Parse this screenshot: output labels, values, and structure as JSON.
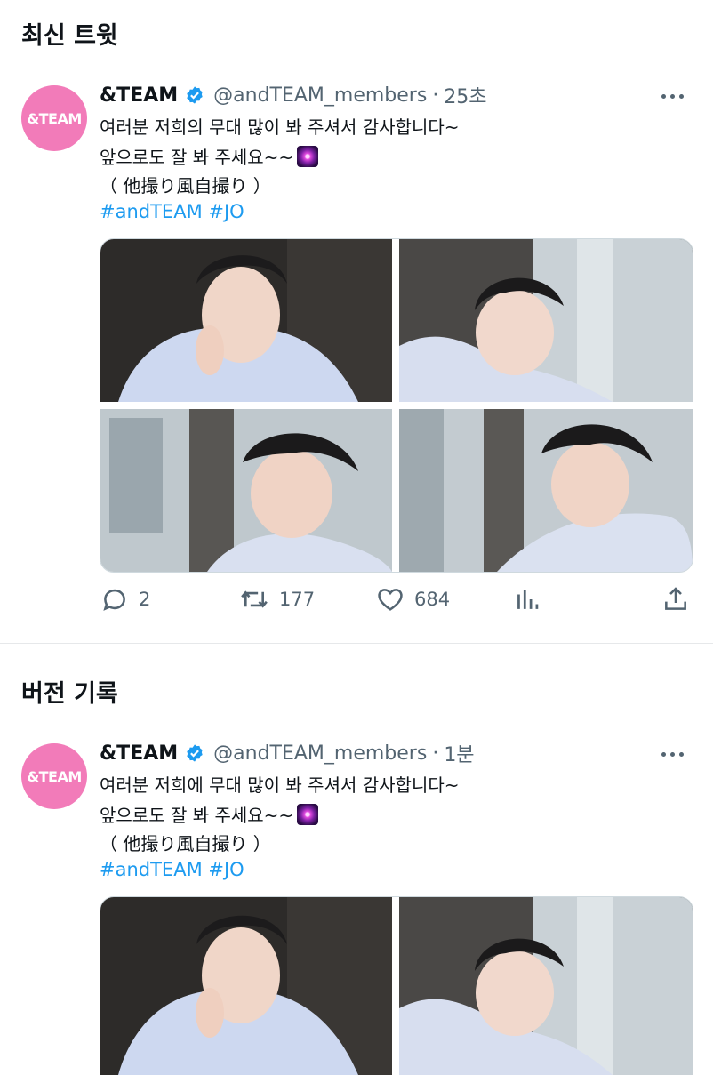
{
  "sections": {
    "latest_title": "최신 트윗",
    "history_title": "버전 기록"
  },
  "tweet_latest": {
    "avatar_text": "&TEAM",
    "name": "&TEAM",
    "handle": "@andTEAM_members",
    "separator": "·",
    "time": "25초",
    "line1": "여러분 저희의 무대 많이 봐 주셔서 감사합니다~",
    "line2": "앞으로도 잘 봐 주세요~~",
    "line3": "（ 他撮り風自撮り ）",
    "hashtags": "#andTEAM #JO",
    "stats": {
      "replies": "2",
      "retweets": "177",
      "likes": "684"
    }
  },
  "tweet_previous": {
    "avatar_text": "&TEAM",
    "name": "&TEAM",
    "handle": "@andTEAM_members",
    "separator": "·",
    "time": "1분",
    "line1": "여러분 저희에 무대 많이 봐 주셔서 감사합니다~",
    "line2": "앞으로도 잘 봐 주세요~~",
    "line3": "（ 他撮り風自撮り ）",
    "hashtags": "#andTEAM #JO"
  },
  "icons": {
    "verified": "verified-badge-icon",
    "sparkle": "sparkle-emoji-icon",
    "more": "more-icon",
    "reply": "reply-icon",
    "retweet": "retweet-icon",
    "like": "heart-icon",
    "views": "analytics-icon",
    "share": "share-icon"
  },
  "colors": {
    "avatar_bg": "#f27bb9",
    "hashtag": "#1d9bf0",
    "verified": "#1d9bf0",
    "muted": "#536471",
    "text": "#0f1419"
  }
}
